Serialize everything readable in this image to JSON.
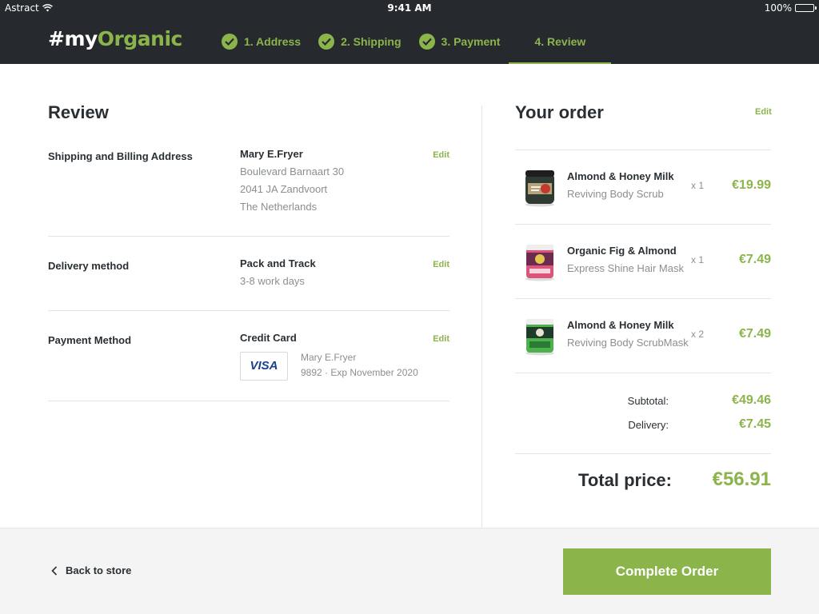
{
  "status_bar": {
    "carrier": "Astract",
    "time": "9:41 AM",
    "battery": "100%"
  },
  "header": {
    "logo_hash": "#my",
    "logo_brand": "Organic",
    "steps": [
      {
        "label": "1. Address",
        "done": true
      },
      {
        "label": "2. Shipping",
        "done": true
      },
      {
        "label": "3. Payment",
        "done": true
      },
      {
        "label": "4. Review",
        "done": false,
        "active": true
      }
    ]
  },
  "review": {
    "title": "Review",
    "edit_label": "Edit",
    "shipping": {
      "label": "Shipping and Billing Address",
      "name": "Mary E.Fryer",
      "street": "Boulevard Barnaart 30",
      "city": "2041 JA Zandvoort",
      "country": "The Netherlands"
    },
    "delivery": {
      "label": "Delivery method",
      "method": "Pack and Track",
      "time": "3-8 work days"
    },
    "payment": {
      "label": "Payment Method",
      "method": "Credit Card",
      "card_brand": "VISA",
      "card_holder": "Mary E.Fryer",
      "card_details": "9892 · Exp November 2020"
    }
  },
  "order": {
    "title": "Your order",
    "edit_label": "Edit",
    "items": [
      {
        "name": "Almond & Honey Milk",
        "desc": "Reviving Body Scrub",
        "qty": "x 1",
        "price": "€19.99",
        "icon": "jar-dark-icon"
      },
      {
        "name": "Organic Fig & Almond",
        "desc": "Express Shine Hair Mask",
        "qty": "x 1",
        "price": "€7.49",
        "icon": "jar-pink-icon"
      },
      {
        "name": "Almond & Honey Milk",
        "desc": "Reviving Body ScrubMask",
        "qty": "x 2",
        "price": "€7.49",
        "icon": "jar-green-icon"
      }
    ],
    "subtotal_label": "Subtotal:",
    "subtotal": "€49.46",
    "delivery_label": "Delivery:",
    "delivery": "€7.45",
    "total_label": "Total price:",
    "total": "€56.91"
  },
  "footer": {
    "back_label": "Back to store",
    "complete_label": "Complete Order"
  },
  "colors": {
    "accent": "#8bb54a",
    "header_bg": "#262a2f",
    "text": "#2a2f33",
    "muted": "#8a8f93"
  }
}
